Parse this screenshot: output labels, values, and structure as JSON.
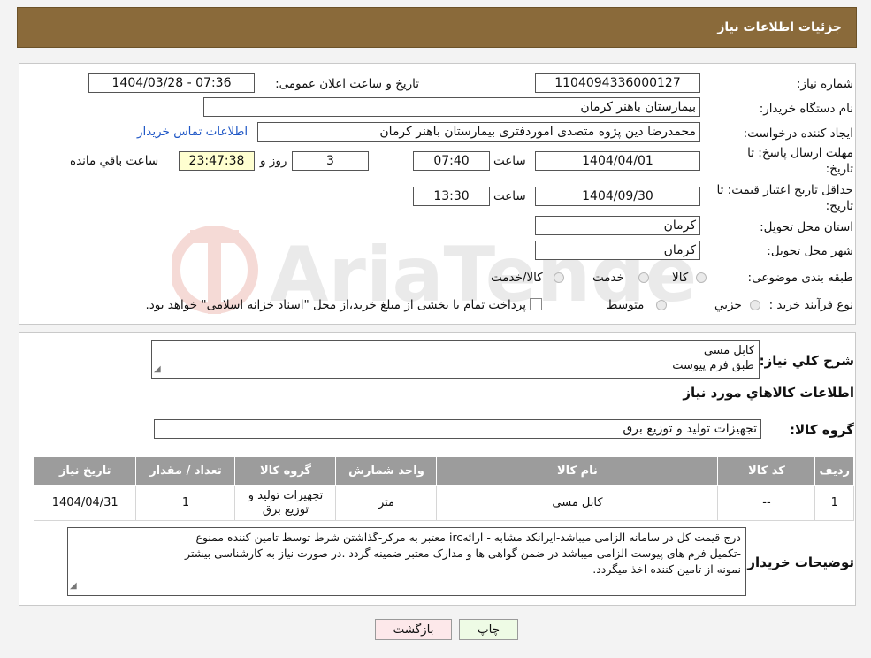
{
  "header": {
    "title": "جزئیات اطلاعات نیاز"
  },
  "form": {
    "need_number": {
      "label": "شماره نیاز:",
      "value": "1104094336000127"
    },
    "announce_datetime": {
      "label": "تاریخ و ساعت اعلان عمومی:",
      "value": "1404/03/28 - 07:36"
    },
    "buyer_org": {
      "label": "نام دستگاه خریدار:",
      "value": "بیمارستان باهنر کرمان"
    },
    "requester": {
      "label": "ایجاد کننده درخواست:",
      "value": "محمدرضا  دین پژوه متصدی اموردفتری بیمارستان باهنر کرمان",
      "contact_link": "اطلاعات تماس خریدار"
    },
    "reply_deadline": {
      "label_line1": "مهلت ارسال پاسخ: تا",
      "label_line2": "تاریخ:",
      "date": "1404/04/01",
      "time_label": "ساعت",
      "time": "07:40",
      "days": "3",
      "days_label": "روز و",
      "remaining": "23:47:38",
      "remaining_label": "ساعت باقي مانده"
    },
    "price_validity": {
      "label_line1": "حداقل تاریخ اعتبار قیمت: تا",
      "label_line2": "تاریخ:",
      "date": "1404/09/30",
      "time_label": "ساعت",
      "time": "13:30"
    },
    "province": {
      "label": "استان محل تحویل:",
      "value": "کرمان"
    },
    "city": {
      "label": "شهر محل تحویل:",
      "value": "کرمان"
    },
    "category": {
      "label": "طبقه بندی موضوعی:",
      "options": [
        "کالا",
        "خدمت",
        "کالا/خدمت"
      ]
    },
    "purchase_type": {
      "label": "نوع فرآیند خرید :",
      "options": [
        "جزیي",
        "متوسط"
      ],
      "note": "پرداخت تمام یا بخشی از مبلغ خرید،از محل \"اسناد خزانه اسلامی\" خواهد بود."
    }
  },
  "description": {
    "label": "شرح کلي نياز:",
    "lines": [
      "کابل مسی",
      "طبق فرم پیوست"
    ]
  },
  "goods_info": {
    "title": "اطلاعات کالاهاي مورد نياز"
  },
  "goods_group": {
    "label": "گروه کالا:",
    "value": "تجهیزات تولید و توزیع برق"
  },
  "table": {
    "headers": [
      "رديف",
      "کد کالا",
      "نام کالا",
      "واحد شمارش",
      "گروه کالا",
      "تعداد / مقدار",
      "تاريخ نياز"
    ],
    "rows": [
      [
        "1",
        "--",
        "کابل مسی",
        "متر",
        "تجهیزات تولید و توزیع برق",
        "1",
        "1404/04/31"
      ]
    ]
  },
  "buyer_notes": {
    "label": "توضیحات خریدار:",
    "lines": [
      "درج قیمت کل در سامانه الزامی میباشد-ایرانکد مشابه - ارائهirc معتبر به مرکز-گذاشتن شرط توسط تامین کننده ممنوع",
      "-تکمیل فرم های پیوست الزامی میباشد در ضمن گواهی ها و مدارک معتبر ضمینه گردد .در صورت نیاز به کارشناسی بیشتر",
      "نمونه از تامین کننده اخذ میگردد."
    ]
  },
  "buttons": {
    "print": "چاپ",
    "back": "بازگشت"
  },
  "colors": {
    "header_bg": "#8a6a3a",
    "table_header_bg": "#9c9c9c",
    "timer_bg": "#ffffd0",
    "link": "#1f57c6",
    "print_bg": "#eefbe5",
    "back_bg": "#fde8ea"
  }
}
